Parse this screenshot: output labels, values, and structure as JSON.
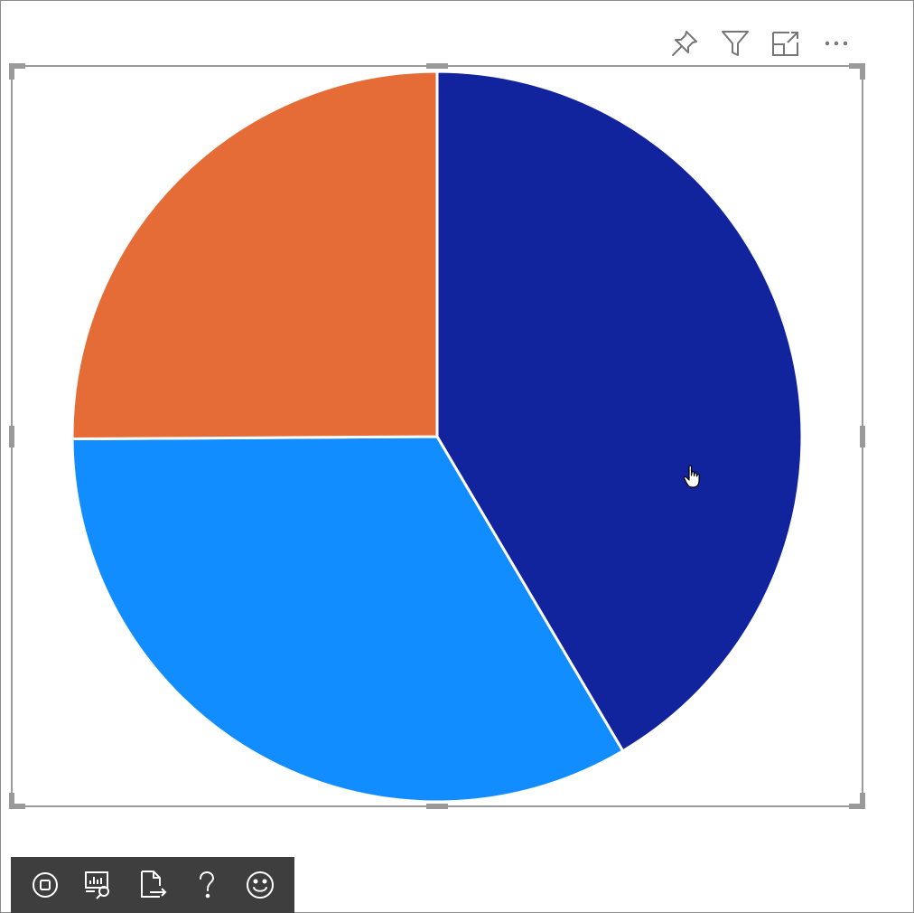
{
  "colors": {
    "slice_navy": "#12239E",
    "slice_blue": "#118DFF",
    "slice_orange": "#E66C37",
    "toolbar_bg": "#3E3E3E",
    "icon_gray": "#757575",
    "handle_gray": "#9A9A9A"
  },
  "visual_header": {
    "icons": [
      "pin-icon",
      "filter-icon",
      "focus-mode-icon",
      "more-options-icon"
    ]
  },
  "bottom_toolbar": {
    "icons": [
      "stop-icon",
      "performance-analyzer-icon",
      "export-icon",
      "help-icon",
      "feedback-smiley-icon"
    ]
  },
  "chart_data": {
    "type": "pie",
    "start_angle_deg": 0,
    "direction": "clockwise",
    "slices": [
      {
        "value": 41.5,
        "color": "#12239E"
      },
      {
        "value": 33.4,
        "color": "#118DFF"
      },
      {
        "value": 25.1,
        "color": "#E66C37"
      }
    ],
    "legend": "none",
    "data_labels": "none"
  }
}
